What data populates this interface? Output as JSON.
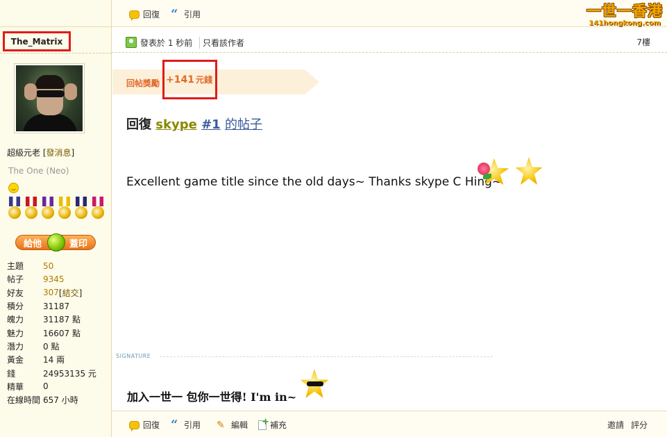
{
  "topbar": {
    "reply_label": "回復",
    "quote_label": "引用"
  },
  "logo": {
    "main": "一世一香港",
    "sub": "141hongkong.com"
  },
  "user": {
    "name": "The_Matrix",
    "rank": "超級元老",
    "pm_label": "發消息",
    "custom_title": "The One (Neo)",
    "give_stamp": {
      "left": "給他",
      "right": "蓋印"
    },
    "stats": [
      {
        "key": "主題",
        "value": "50",
        "link": true
      },
      {
        "key": "帖子",
        "value": "9345",
        "link": true
      },
      {
        "key": "好友",
        "value": "307",
        "link": true,
        "extra": "結交"
      },
      {
        "key": "積分",
        "value": "31187"
      },
      {
        "key": "魄力",
        "value": "31187 點"
      },
      {
        "key": "魅力",
        "value": "16607 點"
      },
      {
        "key": "潛力",
        "value": "0 點"
      },
      {
        "key": "黃金",
        "value": "14 兩"
      },
      {
        "key": "錢",
        "value": "24953135 元"
      },
      {
        "key": "精華",
        "value": "0"
      },
      {
        "key": "在線時間",
        "value": "657 小時"
      }
    ],
    "medal_colors": [
      "#3a3a8a",
      "#c81a1a",
      "#6a2a9a",
      "#e8c000",
      "#2a2a6a",
      "#c81a6a"
    ]
  },
  "post": {
    "posted_at": "發表於 1 秒前",
    "only_author": "只看該作者",
    "floor": "7樓",
    "reward_label": "回帖獎勵",
    "reward_value": "+141",
    "reward_unit": "元錢",
    "reply_prefix": "回復",
    "thread_name": "skype",
    "thread_num": "#1",
    "thread_suffix": "的帖子",
    "message": "Excellent game title since the old days~ Thanks skype C Hing~",
    "signature_label": "SIGNATURE",
    "signature_text": "加入一世一 包你一世得!  I'm in~"
  },
  "bottombar": {
    "reply_label": "回復",
    "quote_label": "引用",
    "edit_label": "編輯",
    "add_label": "補充",
    "invite_label": "邀請",
    "rate_label": "評分"
  }
}
